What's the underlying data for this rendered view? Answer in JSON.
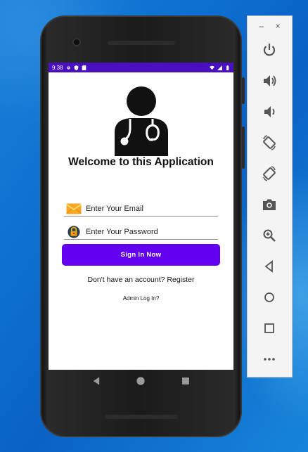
{
  "status_bar": {
    "time": "9:38"
  },
  "app": {
    "welcome_text": "Welcome to this Application",
    "email_placeholder": "Enter Your Email",
    "password_placeholder": "Enter Your Password",
    "signin_label": "Sign In Now",
    "register_text": "Don't have an account? Register",
    "admin_text": "Admin Log In?"
  },
  "emulator_panel": {
    "minimize_label": "–",
    "close_label": "×",
    "buttons": [
      "power-icon",
      "volume-up-icon",
      "volume-down-icon",
      "rotate-left-icon",
      "rotate-right-icon",
      "camera-icon",
      "zoom-icon",
      "back-icon",
      "home-icon",
      "overview-icon",
      "more-icon"
    ]
  },
  "colors": {
    "accent": "#6200ee",
    "status_bar": "#4a0fbf",
    "desktop": "#0c6fd0"
  }
}
